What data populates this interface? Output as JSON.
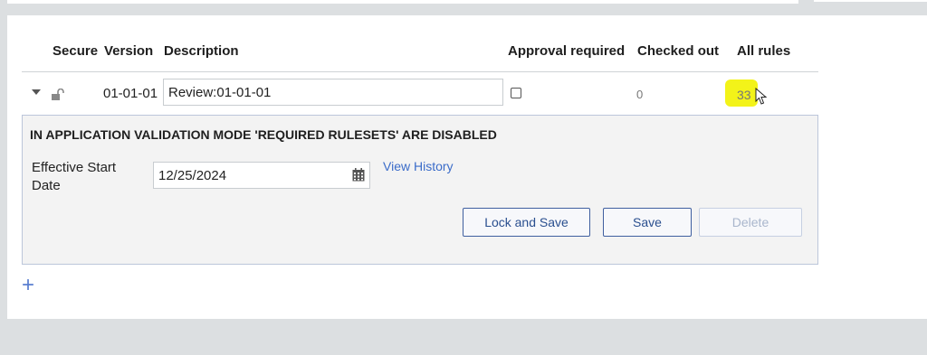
{
  "table": {
    "headers": {
      "secure": "Secure",
      "version": "Version",
      "description": "Description",
      "approval_required": "Approval required",
      "checked_out": "Checked out",
      "all_rules": "All rules"
    },
    "row": {
      "version": "01-01-01",
      "description": "Review:01-01-01",
      "approval_required": false,
      "checked_out": "0",
      "all_rules": "33"
    }
  },
  "details": {
    "warning": "IN APPLICATION VALIDATION MODE 'REQUIRED RULESETS' ARE DISABLED",
    "effective_start_label": "Effective Start Date",
    "effective_start_value": "12/25/2024",
    "view_history": "View History",
    "buttons": {
      "lock_and_save": "Lock and Save",
      "save": "Save",
      "delete": "Delete"
    }
  },
  "add_row": "+",
  "colors": {
    "accent": "#3b6cc9",
    "highlight": "#f2f200",
    "panel_bg": "#f3f3f3",
    "page_bg": "#dcdfe1"
  }
}
